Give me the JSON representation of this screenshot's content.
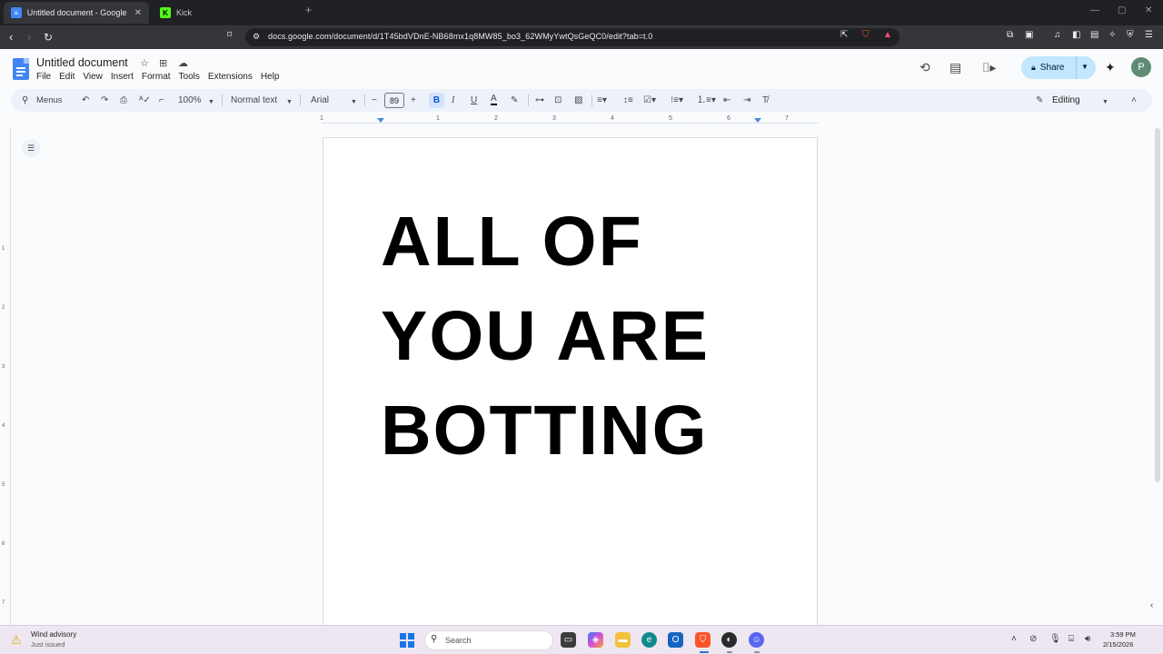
{
  "browser": {
    "tabs": [
      {
        "label": "Untitled document - Google Docs",
        "active": true
      },
      {
        "label": "Kick",
        "active": false
      }
    ],
    "new_tab": "+",
    "url": "docs.google.com/document/d/1T45bdVDnE-NB68mx1q8MW85_bo3_62WMyYwtQsGeQC0/edit?tab=t.0"
  },
  "docs": {
    "title": "Untitled document",
    "menu": [
      "File",
      "Edit",
      "View",
      "Insert",
      "Format",
      "Tools",
      "Extensions",
      "Help"
    ],
    "share_label": "Share",
    "avatar_initial": "P"
  },
  "toolbar": {
    "search_menus": "Menus",
    "zoom": "100%",
    "style": "Normal text",
    "font": "Arial",
    "font_size": "89",
    "mode": "Editing"
  },
  "ruler": {
    "h_numbers": [
      "1",
      "1",
      "2",
      "3",
      "4",
      "5",
      "6",
      "7"
    ],
    "v_numbers": [
      "1",
      "2",
      "3",
      "4",
      "5",
      "6",
      "7"
    ]
  },
  "document": {
    "lines": [
      "ALL OF",
      "YOU ARE",
      "BOTTING"
    ]
  },
  "taskbar": {
    "weather_title": "Wind advisory",
    "weather_sub": "Just issued",
    "search": "Search",
    "time": "3:59 PM",
    "date": "2/15/2026"
  },
  "colors": {
    "share_bg": "#c2e7ff",
    "toolbar_bg": "#edf2fa",
    "docs_blue": "#4285f4",
    "bold_active": "#d3e3fd"
  }
}
